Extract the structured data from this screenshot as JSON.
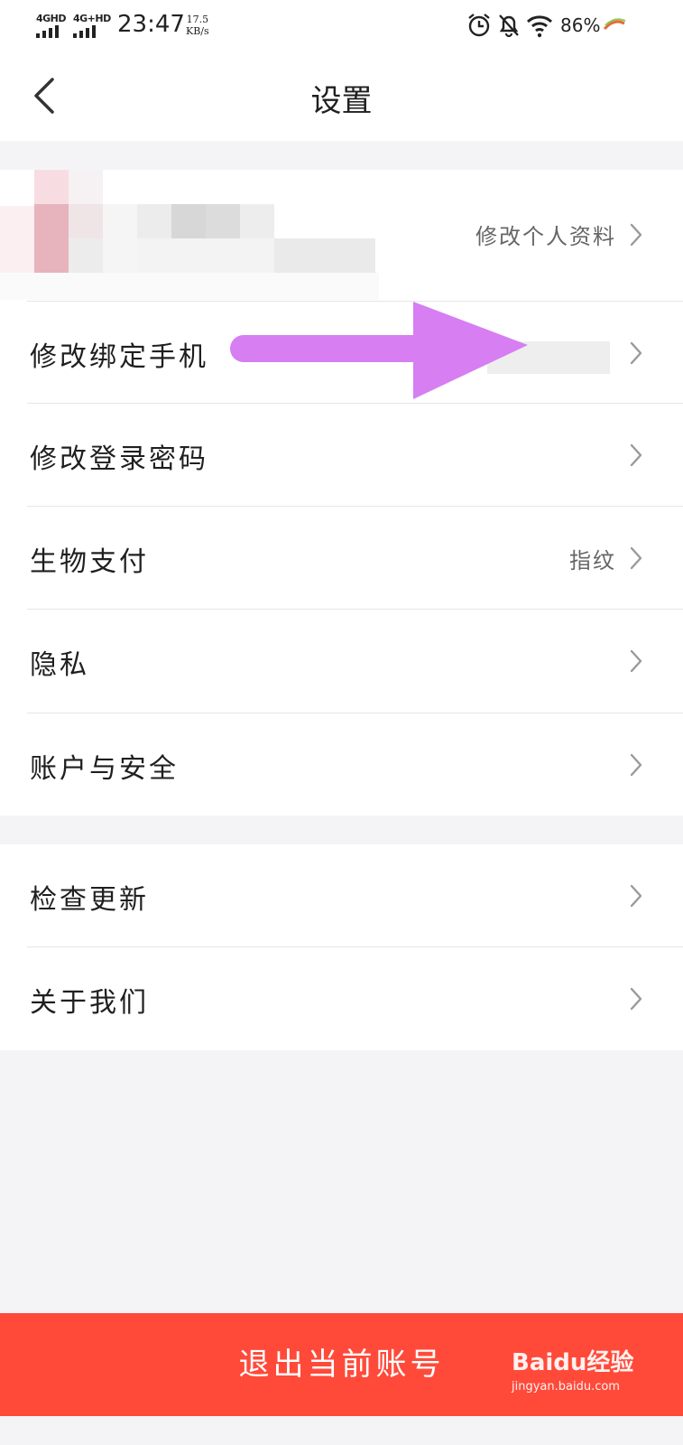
{
  "status_bar": {
    "network1": "4GHD",
    "network2": "4G+HD",
    "time": "23:47",
    "speed_value": "17.5",
    "speed_unit": "KB/s",
    "battery": "86%"
  },
  "nav": {
    "title": "设置"
  },
  "profile": {
    "edit_label": "修改个人资料"
  },
  "menu": [
    {
      "label": "修改绑定手机",
      "value": ""
    },
    {
      "label": "修改登录密码",
      "value": ""
    },
    {
      "label": "生物支付",
      "value": "指纹"
    },
    {
      "label": "隐私",
      "value": ""
    },
    {
      "label": "账户与安全",
      "value": ""
    }
  ],
  "menu2": [
    {
      "label": "检查更新"
    },
    {
      "label": "关于我们"
    }
  ],
  "logout_label": "退出当前账号",
  "watermark": {
    "brand": "Baidu经验",
    "url": "jingyan.baidu.com"
  },
  "colors": {
    "accent": "#ff4a3a",
    "annotation_arrow": "#d67ef2",
    "background": "#f4f4f6"
  }
}
